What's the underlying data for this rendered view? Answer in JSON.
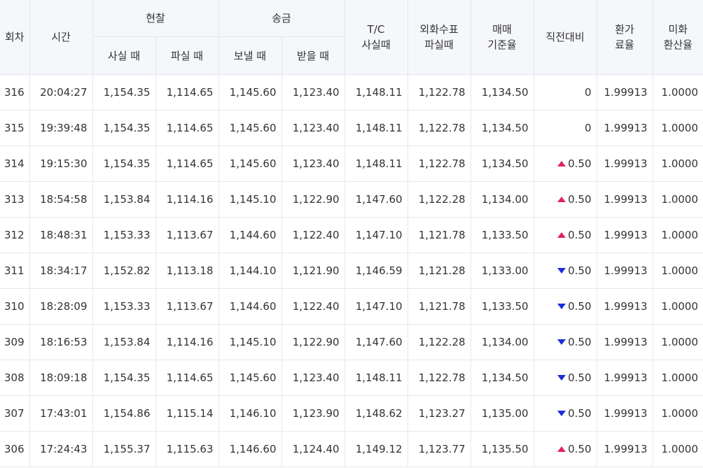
{
  "headers": {
    "round": "회차",
    "time": "시간",
    "cash": "현찰",
    "cash_buy": "사실 때",
    "cash_sell": "파실 때",
    "remit": "송금",
    "remit_send": "보낼 때",
    "remit_receive": "받을 때",
    "tc_line1": "T/C",
    "tc_line2": "사실때",
    "fx_check_line1": "외화수표",
    "fx_check_line2": "파실때",
    "base_line1": "매매",
    "base_line2": "기준율",
    "change": "직전대비",
    "exchange_line1": "환가",
    "exchange_line2": "료율",
    "usd_line1": "미화",
    "usd_line2": "환산율"
  },
  "rows": [
    {
      "round": "316",
      "time": "20:04:27",
      "cash_buy": "1,154.35",
      "cash_sell": "1,114.65",
      "remit_send": "1,145.60",
      "remit_receive": "1,123.40",
      "tc_buy": "1,148.11",
      "fx_check_sell": "1,122.78",
      "base_rate": "1,134.50",
      "change": "0",
      "direction": "none",
      "exchange_fee": "1.99913",
      "usd_rate": "1.0000"
    },
    {
      "round": "315",
      "time": "19:39:48",
      "cash_buy": "1,154.35",
      "cash_sell": "1,114.65",
      "remit_send": "1,145.60",
      "remit_receive": "1,123.40",
      "tc_buy": "1,148.11",
      "fx_check_sell": "1,122.78",
      "base_rate": "1,134.50",
      "change": "0",
      "direction": "none",
      "exchange_fee": "1.99913",
      "usd_rate": "1.0000"
    },
    {
      "round": "314",
      "time": "19:15:30",
      "cash_buy": "1,154.35",
      "cash_sell": "1,114.65",
      "remit_send": "1,145.60",
      "remit_receive": "1,123.40",
      "tc_buy": "1,148.11",
      "fx_check_sell": "1,122.78",
      "base_rate": "1,134.50",
      "change": "0.50",
      "direction": "up",
      "exchange_fee": "1.99913",
      "usd_rate": "1.0000"
    },
    {
      "round": "313",
      "time": "18:54:58",
      "cash_buy": "1,153.84",
      "cash_sell": "1,114.16",
      "remit_send": "1,145.10",
      "remit_receive": "1,122.90",
      "tc_buy": "1,147.60",
      "fx_check_sell": "1,122.28",
      "base_rate": "1,134.00",
      "change": "0.50",
      "direction": "up",
      "exchange_fee": "1.99913",
      "usd_rate": "1.0000"
    },
    {
      "round": "312",
      "time": "18:48:31",
      "cash_buy": "1,153.33",
      "cash_sell": "1,113.67",
      "remit_send": "1,144.60",
      "remit_receive": "1,122.40",
      "tc_buy": "1,147.10",
      "fx_check_sell": "1,121.78",
      "base_rate": "1,133.50",
      "change": "0.50",
      "direction": "up",
      "exchange_fee": "1.99913",
      "usd_rate": "1.0000"
    },
    {
      "round": "311",
      "time": "18:34:17",
      "cash_buy": "1,152.82",
      "cash_sell": "1,113.18",
      "remit_send": "1,144.10",
      "remit_receive": "1,121.90",
      "tc_buy": "1,146.59",
      "fx_check_sell": "1,121.28",
      "base_rate": "1,133.00",
      "change": "0.50",
      "direction": "down",
      "exchange_fee": "1.99913",
      "usd_rate": "1.0000"
    },
    {
      "round": "310",
      "time": "18:28:09",
      "cash_buy": "1,153.33",
      "cash_sell": "1,113.67",
      "remit_send": "1,144.60",
      "remit_receive": "1,122.40",
      "tc_buy": "1,147.10",
      "fx_check_sell": "1,121.78",
      "base_rate": "1,133.50",
      "change": "0.50",
      "direction": "down",
      "exchange_fee": "1.99913",
      "usd_rate": "1.0000"
    },
    {
      "round": "309",
      "time": "18:16:53",
      "cash_buy": "1,153.84",
      "cash_sell": "1,114.16",
      "remit_send": "1,145.10",
      "remit_receive": "1,122.90",
      "tc_buy": "1,147.60",
      "fx_check_sell": "1,122.28",
      "base_rate": "1,134.00",
      "change": "0.50",
      "direction": "down",
      "exchange_fee": "1.99913",
      "usd_rate": "1.0000"
    },
    {
      "round": "308",
      "time": "18:09:18",
      "cash_buy": "1,154.35",
      "cash_sell": "1,114.65",
      "remit_send": "1,145.60",
      "remit_receive": "1,123.40",
      "tc_buy": "1,148.11",
      "fx_check_sell": "1,122.78",
      "base_rate": "1,134.50",
      "change": "0.50",
      "direction": "down",
      "exchange_fee": "1.99913",
      "usd_rate": "1.0000"
    },
    {
      "round": "307",
      "time": "17:43:01",
      "cash_buy": "1,154.86",
      "cash_sell": "1,115.14",
      "remit_send": "1,146.10",
      "remit_receive": "1,123.90",
      "tc_buy": "1,148.62",
      "fx_check_sell": "1,123.27",
      "base_rate": "1,135.00",
      "change": "0.50",
      "direction": "down",
      "exchange_fee": "1.99913",
      "usd_rate": "1.0000"
    },
    {
      "round": "306",
      "time": "17:24:43",
      "cash_buy": "1,155.37",
      "cash_sell": "1,115.63",
      "remit_send": "1,146.60",
      "remit_receive": "1,124.40",
      "tc_buy": "1,149.12",
      "fx_check_sell": "1,123.77",
      "base_rate": "1,135.50",
      "change": "0.50",
      "direction": "up",
      "exchange_fee": "1.99913",
      "usd_rate": "1.0000"
    }
  ],
  "colors": {
    "up": "#e0245e",
    "down": "#1a2fd6",
    "header_bg": "#f5f7fb"
  }
}
